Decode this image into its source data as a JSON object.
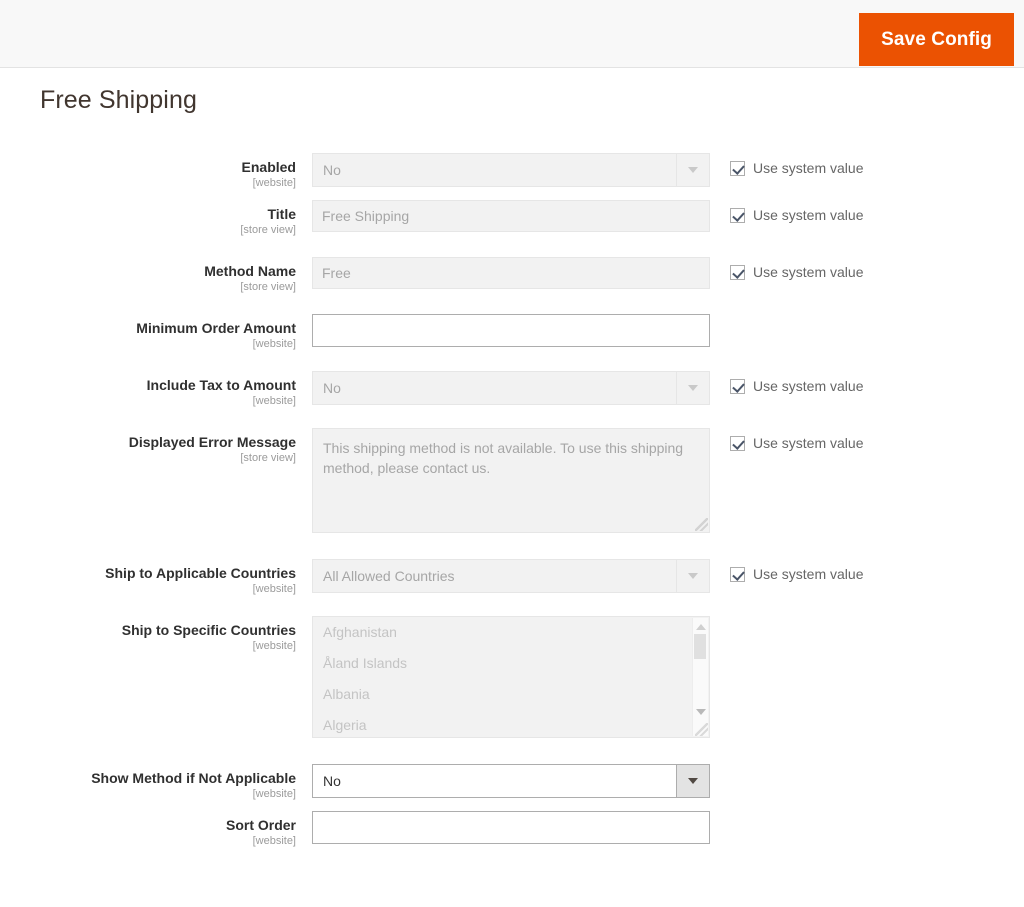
{
  "header": {
    "save_label": "Save Config",
    "accent_color": "#eb5202"
  },
  "page": {
    "title": "Free Shipping"
  },
  "system_value_label": "Use system value",
  "fields": [
    {
      "label": "Enabled",
      "scope": "[website]",
      "type": "select",
      "value": "No",
      "disabled": true,
      "has_system_value": true
    },
    {
      "label": "Title",
      "scope": "[store view]",
      "type": "text",
      "value": "Free Shipping",
      "disabled": true,
      "has_system_value": true
    },
    {
      "label": "Method Name",
      "scope": "[store view]",
      "type": "text",
      "value": "Free",
      "disabled": true,
      "has_system_value": true
    },
    {
      "label": "Minimum Order Amount",
      "scope": "[website]",
      "type": "text",
      "value": "",
      "disabled": false,
      "has_system_value": false
    },
    {
      "label": "Include Tax to Amount",
      "scope": "[website]",
      "type": "select",
      "value": "No",
      "disabled": true,
      "has_system_value": true
    },
    {
      "label": "Displayed Error Message",
      "scope": "[store view]",
      "type": "textarea",
      "value": "This shipping method is not available. To use this shipping method, please contact us.",
      "disabled": true,
      "has_system_value": true
    },
    {
      "label": "Ship to Applicable Countries",
      "scope": "[website]",
      "type": "select",
      "value": "All Allowed Countries",
      "disabled": true,
      "has_system_value": true
    },
    {
      "label": "Ship to Specific Countries",
      "scope": "[website]",
      "type": "multiselect",
      "options": [
        "Afghanistan",
        "Åland Islands",
        "Albania",
        "Algeria"
      ],
      "disabled": true,
      "has_system_value": false
    },
    {
      "label": "Show Method if Not Applicable",
      "scope": "[website]",
      "type": "select",
      "value": "No",
      "disabled": false,
      "has_system_value": false
    },
    {
      "label": "Sort Order",
      "scope": "[website]",
      "type": "text",
      "value": "",
      "disabled": false,
      "has_system_value": false
    }
  ]
}
